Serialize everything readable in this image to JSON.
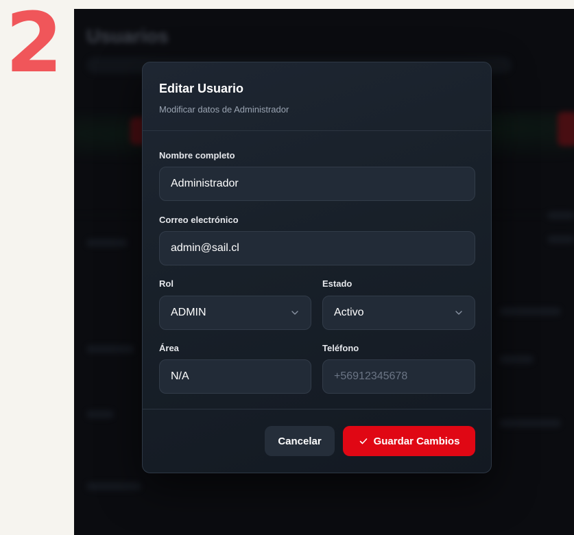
{
  "step_number": "2",
  "background_app": {
    "title": "Usuarios"
  },
  "modal": {
    "title": "Editar Usuario",
    "subtitle": "Modificar datos de Administrador",
    "fields": {
      "name": {
        "label": "Nombre completo",
        "value": "Administrador"
      },
      "email": {
        "label": "Correo electrónico",
        "value": "admin@sail.cl"
      },
      "role": {
        "label": "Rol",
        "value": "ADMIN"
      },
      "status": {
        "label": "Estado",
        "value": "Activo"
      },
      "area": {
        "label": "Área",
        "value": "N/A"
      },
      "phone": {
        "label": "Teléfono",
        "value": "",
        "placeholder": "+56912345678"
      }
    },
    "buttons": {
      "cancel": "Cancelar",
      "save": "Guardar Cambios"
    }
  },
  "colors": {
    "step_number": "#f0565a",
    "primary_button": "#e00714",
    "modal_bg": "#1b232d",
    "page_bg": "#f6f4ef"
  },
  "icons": {
    "select_chevron": "chevron-down-icon",
    "save": "check-icon"
  }
}
